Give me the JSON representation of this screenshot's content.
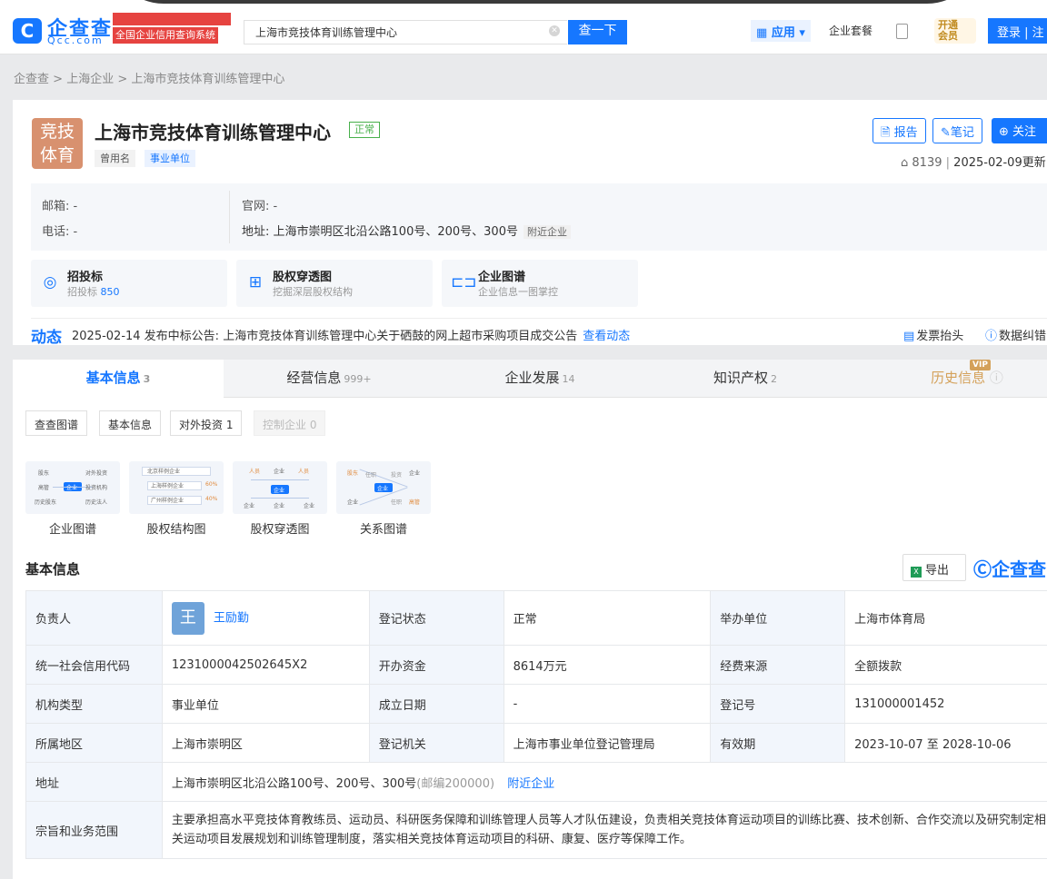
{
  "topbar": {
    "logo_text": "企查查",
    "logo_en": "Qcc.com",
    "slogan": "全国企业信用查询系统",
    "search_value": "上海市竞技体育训练管理中心",
    "search_button": "查一下",
    "app_label": "应用",
    "suite_label": "企业套餐",
    "vip_line1": "开通",
    "vip_line2": "会员",
    "login_label": "登录 | 注册"
  },
  "breadcrumb": [
    "企查查",
    "上海企业",
    "上海市竞技体育训练管理中心"
  ],
  "company": {
    "logo_line1": "竞技",
    "logo_line2": "体育",
    "name": "上海市竞技体育训练管理中心",
    "status": "正常",
    "tag_former": "曾用名",
    "tag_type": "事业单位",
    "btn_report": "报告",
    "btn_note": "笔记",
    "btn_follow": "关注",
    "views": "8139",
    "updated": "2025-02-09更新"
  },
  "contact": {
    "email_label": "邮箱:",
    "email_value": "-",
    "phone_label": "电话:",
    "phone_value": "-",
    "site_label": "官网:",
    "site_value": "-",
    "address_label": "地址:",
    "address_value": "上海市崇明区北沿公路100号、200号、300号",
    "nearby": "附近企业"
  },
  "quick": [
    {
      "title": "招投标",
      "sub_prefix": "招投标",
      "sub_count": "850",
      "icon": "target-icon"
    },
    {
      "title": "股权穿透图",
      "sub": "挖掘深层股权结构",
      "icon": "hierarchy-icon"
    },
    {
      "title": "企业图谱",
      "sub": "企业信息一图掌控",
      "icon": "graph-icon"
    }
  ],
  "dynamic": {
    "title": "动态",
    "text": "2025-02-14 发布中标公告: 上海市竞技体育训练管理中心关于硒鼓的网上超市采购项目成交公告",
    "link": "查看动态",
    "invoice": "发票抬头",
    "correction": "数据纠错"
  },
  "tabs": [
    {
      "label": "基本信息",
      "count": "3"
    },
    {
      "label": "经营信息",
      "count": "999+"
    },
    {
      "label": "企业发展",
      "count": "14"
    },
    {
      "label": "知识产权",
      "count": "2"
    },
    {
      "label": "历史信息",
      "count": ""
    }
  ],
  "vip_badge": "VIP",
  "subtabs": [
    "查查图谱",
    "基本信息",
    "对外投资 1",
    "控制企业 0"
  ],
  "thumbs": [
    "企业图谱",
    "股权结构图",
    "股权穿透图",
    "关系图谱"
  ],
  "thumb_text": {
    "g1": [
      "股东",
      "对外投资",
      "高管",
      "投资机构",
      "历史股东",
      "历史法人",
      "企业"
    ],
    "g2": [
      "北京样例企业",
      "上海样例企业",
      "广州样例企业",
      "60%",
      "40%",
      "40%"
    ],
    "g3": [
      "人员",
      "企业",
      "人员",
      "企业",
      "企业",
      "企业",
      "企业"
    ],
    "g4": [
      "股东",
      "任职",
      "投资",
      "企业",
      "企业",
      "企业",
      "任职",
      "高管"
    ]
  },
  "basic": {
    "title": "基本信息",
    "export": "导出",
    "brand": "企查查",
    "rows": [
      [
        {
          "k": "负责人"
        },
        {
          "v": "王励勤",
          "avatar": "王",
          "link": true
        },
        {
          "k": "登记状态"
        },
        {
          "v": "正常"
        },
        {
          "k": "举办单位"
        },
        {
          "v": "上海市体育局"
        }
      ],
      [
        {
          "k": "统一社会信用代码"
        },
        {
          "v": "1231000042502645X2"
        },
        {
          "k": "开办资金"
        },
        {
          "v": "8614万元"
        },
        {
          "k": "经费来源"
        },
        {
          "v": "全额拨款"
        }
      ],
      [
        {
          "k": "机构类型"
        },
        {
          "v": "事业单位"
        },
        {
          "k": "成立日期"
        },
        {
          "v": "-"
        },
        {
          "k": "登记号"
        },
        {
          "v": "131000001452"
        }
      ],
      [
        {
          "k": "所属地区"
        },
        {
          "v": "上海市崇明区"
        },
        {
          "k": "登记机关"
        },
        {
          "v": "上海市事业单位登记管理局"
        },
        {
          "k": "有效期"
        },
        {
          "v": "2023-10-07 至 2028-10-06"
        }
      ]
    ],
    "address_key": "地址",
    "address_value": "上海市崇明区北沿公路100号、200号、300号",
    "postcode": "(邮编200000)",
    "nearby": "附近企业",
    "scope_key": "宗旨和业务范围",
    "scope_value": "主要承担高水平竞技体育教练员、运动员、科研医务保障和训练管理人员等人才队伍建设，负责相关竞技体育运动项目的训练比赛、技术创新、合作交流以及研究制定相关运动项目发展规划和训练管理制度，落实相关竞技体育运动项目的科研、康复、医疗等保障工作。"
  }
}
